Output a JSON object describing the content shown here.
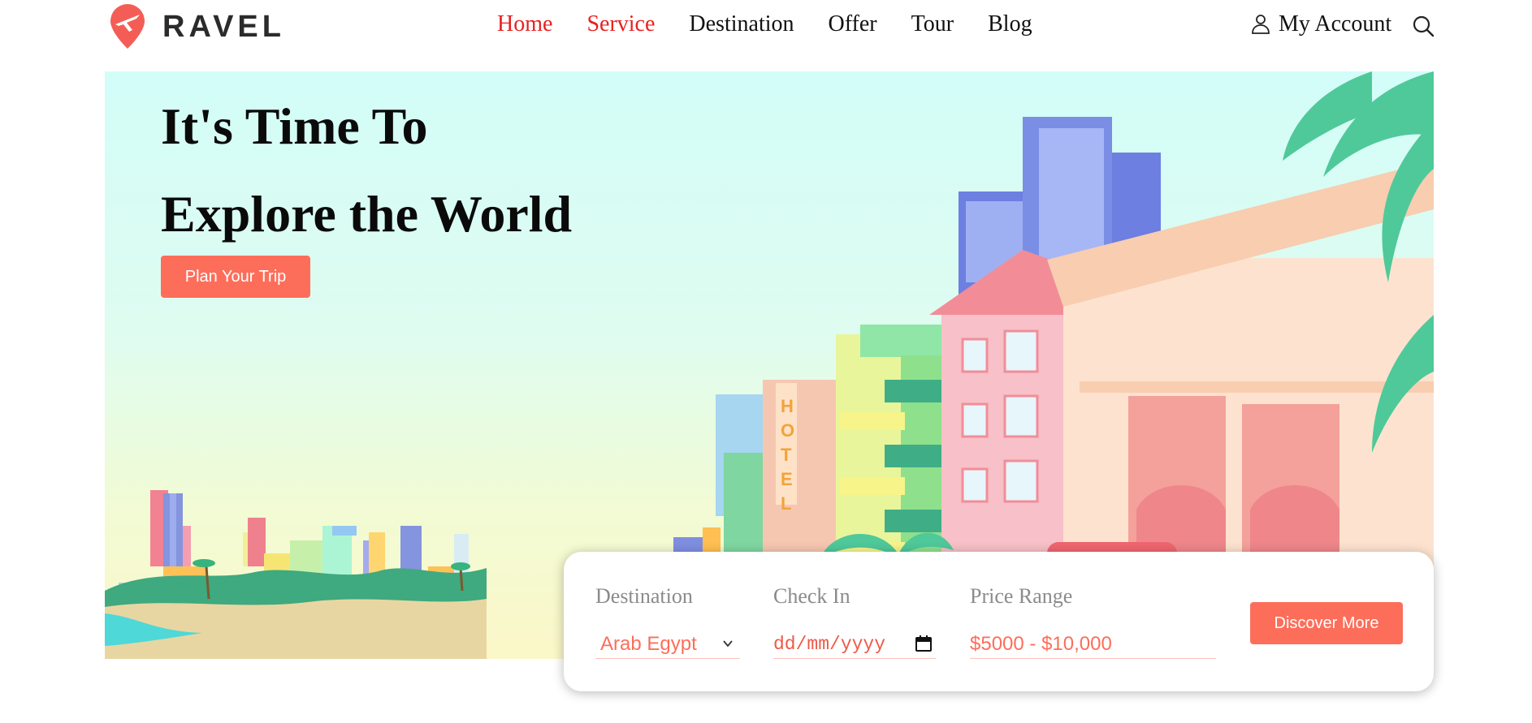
{
  "brand": {
    "name": "RAVEL",
    "accent": "#fd6e5a"
  },
  "nav": {
    "items": [
      {
        "label": "Home",
        "active": true
      },
      {
        "label": "Service",
        "active": true
      },
      {
        "label": "Destination",
        "active": false
      },
      {
        "label": "Offer",
        "active": false
      },
      {
        "label": "Tour",
        "active": false
      },
      {
        "label": "Blog",
        "active": false
      }
    ],
    "active_color": "#e8211f"
  },
  "account": {
    "label": "My Account",
    "icon": "user-icon"
  },
  "search": {
    "icon": "search-icon"
  },
  "hero": {
    "title_line1": "It's Time To",
    "title_line2": "Explore the World",
    "cta_label": "Plan Your Trip"
  },
  "booking": {
    "destination": {
      "label": "Destination",
      "value": "Arab Egypt"
    },
    "check_in": {
      "label": "Check In",
      "placeholder": "dd/mm/yyyy"
    },
    "price_range": {
      "label": "Price Range",
      "value": "$5000 - $10,000"
    },
    "submit_label": "Discover More"
  }
}
